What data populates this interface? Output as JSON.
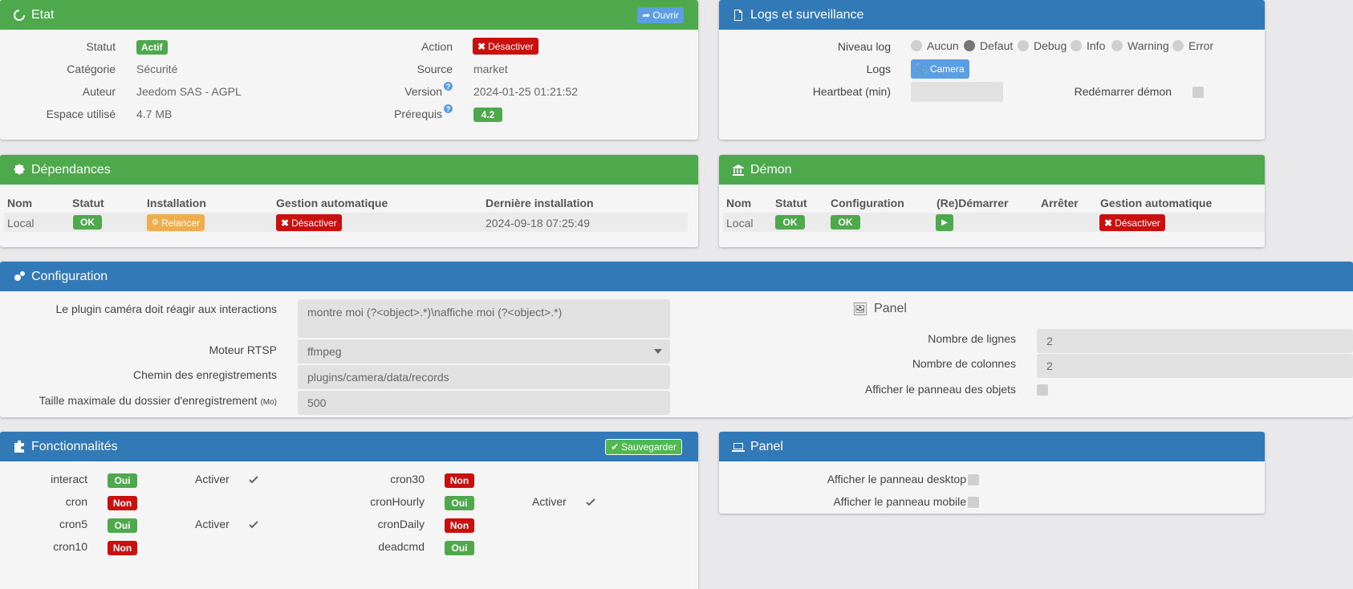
{
  "etat": {
    "title": "Etat",
    "open_label": "Ouvrir",
    "statut_label": "Statut",
    "statut_value": "Actif",
    "categorie_label": "Catégorie",
    "categorie_value": "Sécurité",
    "auteur_label": "Auteur",
    "auteur_value": "Jeedom SAS - AGPL",
    "espace_label": "Espace utilisé",
    "espace_value": "4.7 MB",
    "action_label": "Action",
    "action_button": "Désactiver",
    "source_label": "Source",
    "source_value": "market",
    "version_label": "Version",
    "version_value": "2024-01-25 01:21:52",
    "prerequis_label": "Prérequis",
    "prerequis_value": "4.2",
    "help_mark": "?"
  },
  "logs": {
    "title": "Logs et surveillance",
    "niveau_label": "Niveau log",
    "levels": [
      "Aucun",
      "Defaut",
      "Debug",
      "Info",
      "Warning",
      "Error"
    ],
    "selected_level": "Defaut",
    "logs_label": "Logs",
    "logs_button": "Camera",
    "heartbeat_label": "Heartbeat (min)",
    "heartbeat_value": "",
    "restart_label": "Redémarrer démon"
  },
  "deps": {
    "title": "Dépendances",
    "headers": [
      "Nom",
      "Statut",
      "Installation",
      "Gestion automatique",
      "Dernière installation"
    ],
    "row": {
      "nom": "Local",
      "statut": "OK",
      "install_button": "Relancer",
      "gestion_button": "Désactiver",
      "date": "2024-09-18 07:25:49"
    }
  },
  "demon": {
    "title": "Démon",
    "headers": [
      "Nom",
      "Statut",
      "Configuration",
      "(Re)Démarrer",
      "Arrêter",
      "Gestion automatique"
    ],
    "row": {
      "nom": "Local",
      "statut": "OK",
      "configuration": "OK",
      "gestion_button": "Désactiver"
    }
  },
  "config": {
    "title": "Configuration",
    "interactions_label": "Le plugin caméra doit réagir aux interactions",
    "interactions_value": "montre moi (?<object>.*)\\naffiche moi (?<object>.*)",
    "rtsp_label": "Moteur RTSP",
    "rtsp_value": "ffmpeg",
    "chemin_label": "Chemin des enregistrements",
    "chemin_value": "plugins/camera/data/records",
    "taille_label": "Taille maximale du dossier d'enregistrement",
    "taille_unit": "(Mo)",
    "taille_value": "500",
    "panel_title": "Panel",
    "lignes_label": "Nombre de lignes",
    "lignes_value": "2",
    "colonnes_label": "Nombre de colonnes",
    "colonnes_value": "2",
    "objets_label": "Afficher le panneau des objets"
  },
  "fonct": {
    "title": "Fonctionnalités",
    "save_label": "Sauvegarder",
    "activer_label": "Activer",
    "left": [
      {
        "name": "interact",
        "state": "Oui",
        "activer": true
      },
      {
        "name": "cron",
        "state": "Non",
        "activer": false
      },
      {
        "name": "cron5",
        "state": "Oui",
        "activer": true
      },
      {
        "name": "cron10",
        "state": "Non",
        "activer": false
      }
    ],
    "right": [
      {
        "name": "cron30",
        "state": "Non",
        "activer": false
      },
      {
        "name": "cronHourly",
        "state": "Oui",
        "activer": true
      },
      {
        "name": "cronDaily",
        "state": "Non",
        "activer": false
      },
      {
        "name": "deadcmd",
        "state": "Oui",
        "activer": false
      }
    ]
  },
  "panel2": {
    "title": "Panel",
    "desktop_label": "Afficher le panneau desktop",
    "mobile_label": "Afficher le panneau mobile"
  },
  "colors": {
    "green": "#4ea94c",
    "blue": "#3279b8",
    "red": "#c9100f",
    "orange": "#f0ad4e"
  }
}
